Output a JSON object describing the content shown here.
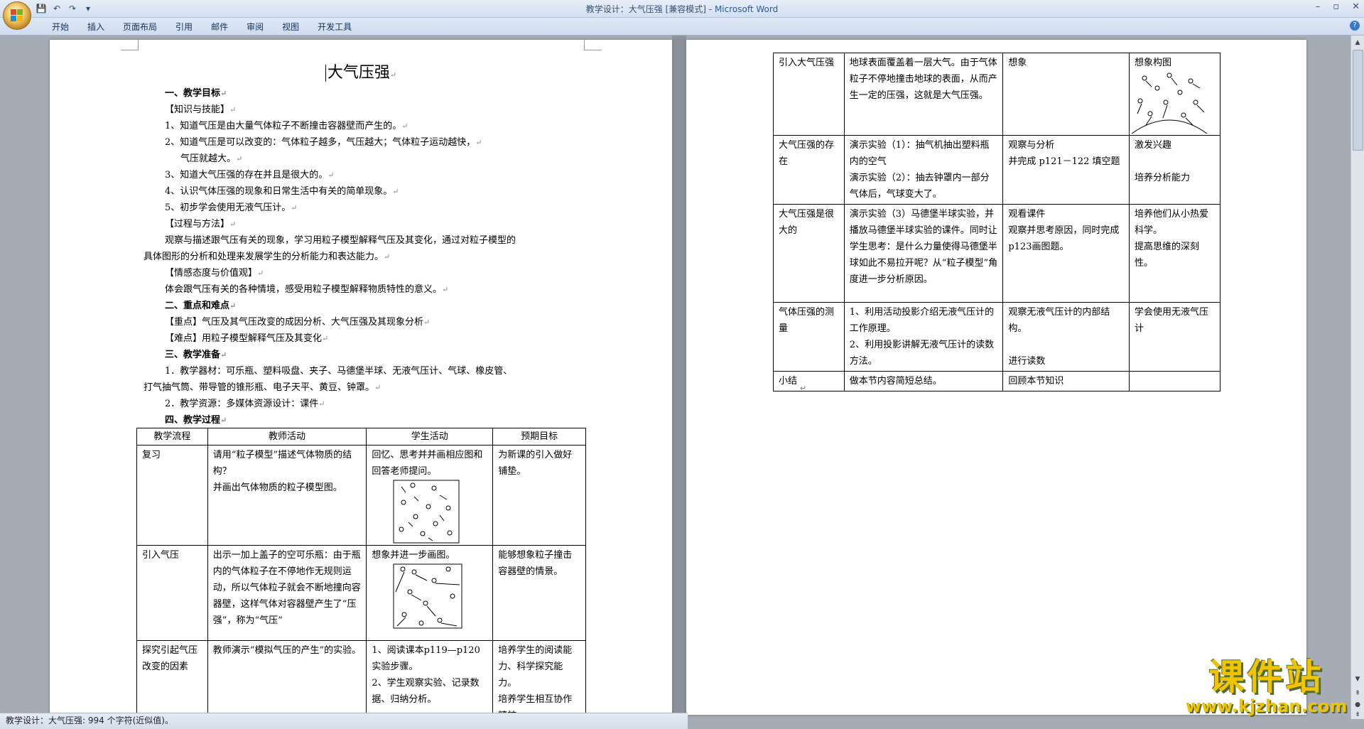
{
  "window": {
    "title": "教学设计：大气压强 [兼容模式]",
    "app_name": "Microsoft Word",
    "separator": " - "
  },
  "ribbon": {
    "tabs": [
      "开始",
      "插入",
      "页面布局",
      "引用",
      "邮件",
      "审阅",
      "视图",
      "开发工具"
    ]
  },
  "document": {
    "title": "大气压强",
    "paras": [
      {
        "text": "一、教学目标",
        "bold": true
      },
      {
        "text": "【知识与技能】"
      },
      {
        "text": "1、知道气压是由大量气体粒子不断撞击容器壁而产生的。"
      },
      {
        "text": "2、知道气压是可以改变的：气体粒子越多，气压越大；气体粒子运动越快，"
      },
      {
        "text": "气压就越大。"
      },
      {
        "text": "3、知道大气压强的存在并且是很大的。"
      },
      {
        "text": "4、认识气体压强的现象和日常生活中有关的简单现象。"
      },
      {
        "text": "5、初步学会使用无液气压计。"
      },
      {
        "text": "【过程与方法】"
      },
      {
        "text": "观察与描述跟气压有关的现象，学习用粒子模型解释气压及其变化，通过对粒子模型的"
      },
      {
        "text": "具体图形的分析和处理来发展学生的分析能力和表达能力。"
      },
      {
        "text": "【情感态度与价值观】"
      },
      {
        "text": "体会跟气压有关的各种情境，感受用粒子模型解释物质特性的意义。"
      },
      {
        "text": "二、重点和难点",
        "bold": true
      },
      {
        "text": "【重点】气压及其气压改变的成因分析、大气压强及其现象分析"
      },
      {
        "text": "【难点】用粒子模型解释气压及其变化"
      },
      {
        "text": "三、教学准备",
        "bold": true
      },
      {
        "text": "1．教学器材：可乐瓶、塑料吸盘、夹子、马德堡半球、无液气压计、气球、橡皮管、"
      },
      {
        "text": "打气抽气筒、带导管的锥形瓶、电子天平、黄豆、钟罩。"
      },
      {
        "text": "2．教学资源：多媒体资源设计：课件"
      },
      {
        "text": "四、教学过程",
        "bold": true
      }
    ],
    "table1": {
      "headers": [
        "教学流程",
        "教师活动",
        "学生活动",
        "预期目标"
      ],
      "rows": [
        {
          "c1": "复习",
          "c2a": "请用“粒子模型”描述气体物质的结构？",
          "c2b": "并画出气体物质的粒子模型图。",
          "c3": "回忆、思考并并画相应图和回答老师提问。",
          "c4": "为新课的引入做好铺垫。"
        },
        {
          "c1": "引入气压",
          "c2a": "出示一加上盖子的空可乐瓶：由于瓶内的气体粒子在不停地作无规则运动，所以气体粒子就会不断地撞向容器壁，这样气体对容器壁产生了“压强”，称为“气压”",
          "c3": "想象并进一步画图。",
          "c4": "能够想象粒子撞击容器壁的情景。"
        },
        {
          "c1": "探究引起气压改变的因素",
          "c2a": "教师演示“模拟气压的产生”的实验。",
          "c3a": "1、阅读课本p119—p120实验步骤。",
          "c3b": "2、学生观察实验、记录数据、归纳分析。",
          "c4a": "培养学生的阅读能力、科学探究能力。",
          "c4b": "培养学生相互协作精神"
        }
      ]
    },
    "table2": {
      "rows": [
        {
          "c1": "引入大气压强",
          "c2": "地球表面覆盖着一层大气。由于气体粒子不停地撞击地球的表面，从而产生一定的压强，这就是大气压强。",
          "c3": "想象",
          "c4": "想象构图"
        },
        {
          "c1": "大气压强的存在",
          "c2a": "演示实验（1）：抽气机抽出塑料瓶内的空气",
          "c2b": "演示实验（2）：抽去钟罩内一部分气体后，气球变大了。",
          "c3a": "观察与分析",
          "c3b": "并完成 p121－122 填空题",
          "c4a": "激发兴趣",
          "c4b": "培养分析能力"
        },
        {
          "c1": "大气压强是很大的",
          "c2": "演示实验（3）马德堡半球实验，并播放马德堡半球实验的课件。同时让学生思考：是什么力量使得马德堡半球如此不易拉开呢？从“粒子模型”角度进一步分析原因。",
          "c3a": "观看课件",
          "c3b": "观察并思考原因，同时完成p123画图题。",
          "c4a": "培养他们从小热爱科学。",
          "c4b": "提高思维的深刻性。"
        },
        {
          "c1": "气体压强的测量",
          "c2a": "1、利用活动投影介绍无液气压计的工作原理。",
          "c2b": "2、利用投影讲解无液气压计的读数方法。",
          "c3a": "观察无液气压计的内部结构。",
          "c3b": "进行读数",
          "c4": "学会使用无液气压计"
        },
        {
          "c1": "小结",
          "c2": "做本节内容简短总结。",
          "c3": "回顾本节知识",
          "c4": ""
        }
      ]
    }
  },
  "status": {
    "text": "教学设计：大气压强: 994 个字符(近似值)。"
  },
  "watermark": {
    "big": "课件站",
    "url": "www.kjzhan.com"
  }
}
